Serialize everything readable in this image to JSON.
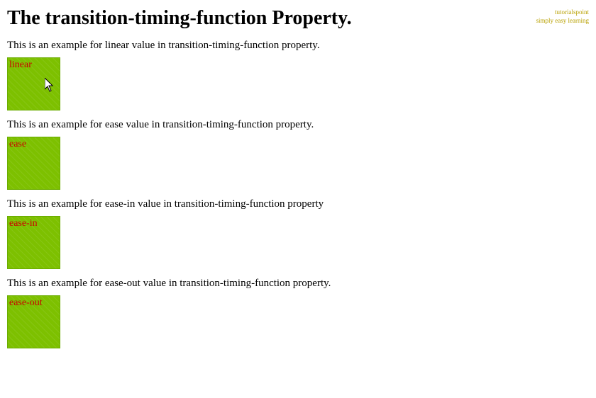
{
  "page": {
    "title": "The transition-timing-function Property.",
    "watermark_line1": "tutorialspoint",
    "watermark_line2": "simply easy learning"
  },
  "sections": [
    {
      "description": "This is an example for linear value in transition-timing-function property.",
      "box_label": "linear",
      "timing": "linear"
    },
    {
      "description": "This is an example for ease value in transition-timing-function property.",
      "box_label": "ease",
      "timing": "ease"
    },
    {
      "description": "This is an example for ease-in value in transition-timing-function property",
      "box_label": "ease-in",
      "timing": "ease-in"
    },
    {
      "description": "This is an example for ease-out value in transition-timing-function property.",
      "box_label": "ease-out",
      "timing": "ease-out"
    }
  ]
}
